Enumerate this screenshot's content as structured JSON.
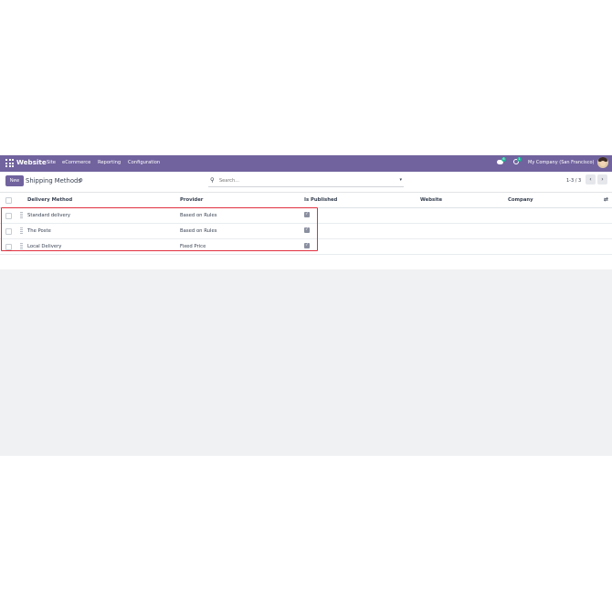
{
  "navbar": {
    "app_name": "Website",
    "menu": [
      "Site",
      "eCommerce",
      "Reporting",
      "Configuration"
    ],
    "messages_badge": "6",
    "activity_badge": "1",
    "company": "My Company (San Francisco)"
  },
  "control": {
    "new_label": "New",
    "breadcrumb": "Shipping Methods",
    "search_placeholder": "Search...",
    "pager": "1-3 / 3"
  },
  "table": {
    "columns": [
      "Delivery Method",
      "Provider",
      "Is Published",
      "Website",
      "Company"
    ],
    "rows": [
      {
        "name": "Standard delivery",
        "provider": "Based on Rules",
        "published": true
      },
      {
        "name": "The Poste",
        "provider": "Based on Rules",
        "published": true
      },
      {
        "name": "Local Delivery",
        "provider": "Fixed Price",
        "published": true
      }
    ]
  },
  "colors": {
    "brand": "#71639e",
    "highlight": "#e0303f"
  }
}
